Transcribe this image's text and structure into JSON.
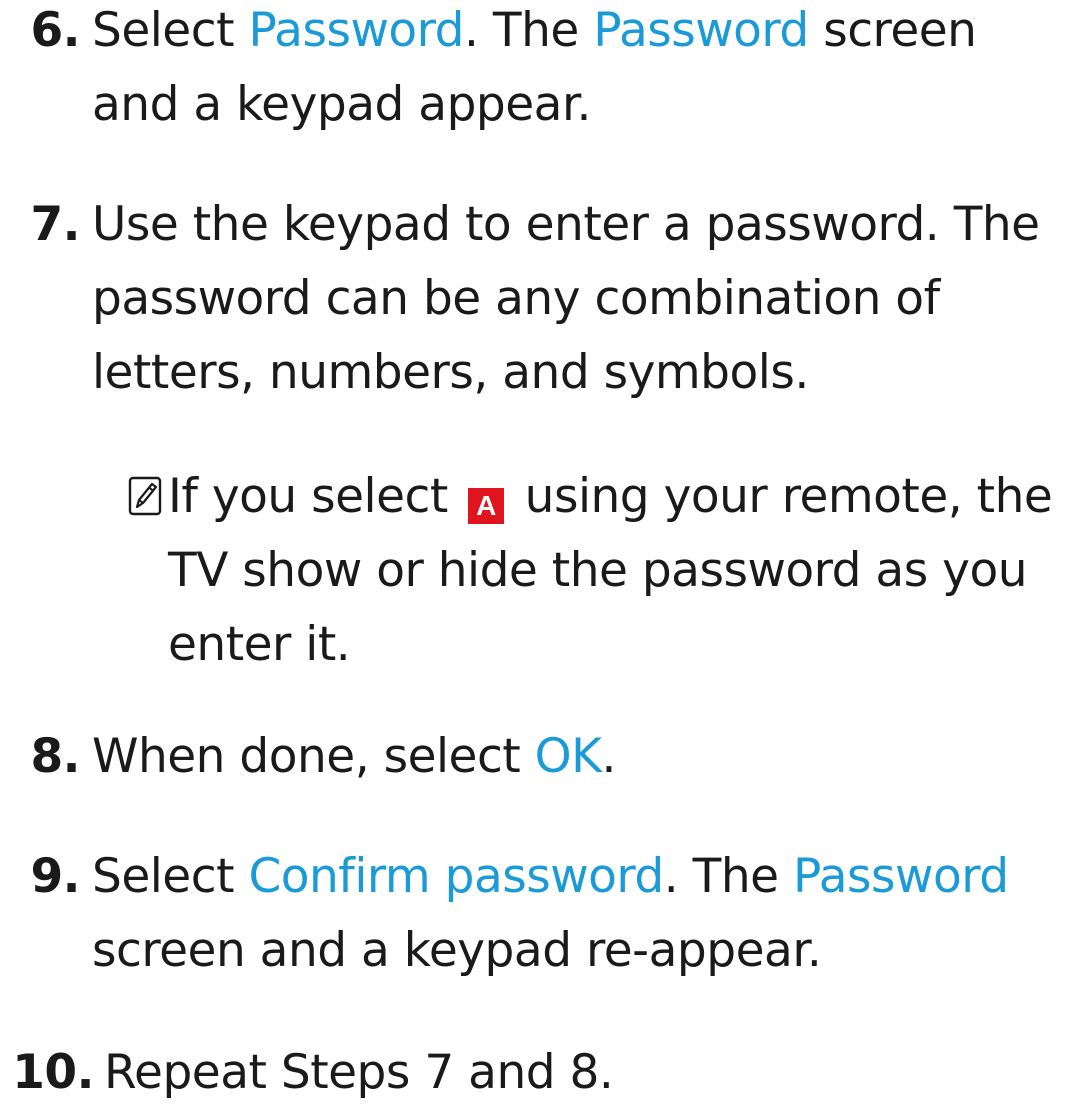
{
  "steps": [
    {
      "number": "6.",
      "parts": [
        "Select ",
        "Password",
        ". The ",
        "Password",
        " screen",
        "and a keypad appear."
      ]
    },
    {
      "number": "7.",
      "lines": [
        "Use the keypad to enter a password. The",
        "password can be any combination of",
        "letters, numbers, and symbols."
      ]
    },
    {
      "number": "8.",
      "parts": [
        "When done, select ",
        "OK",
        "."
      ]
    },
    {
      "number": "9.",
      "parts": [
        "Select ",
        "Confirm password",
        ". The ",
        "Password",
        "screen and a keypad re-appear."
      ]
    },
    {
      "number": "10.",
      "text": "Repeat Steps 7 and 8."
    }
  ],
  "note": {
    "icon": "note-pencil-icon",
    "before": "If you select",
    "button_label": "A",
    "button_color": "#e0141e",
    "after_line1": "using your remote, the",
    "line2": "TV show or hide the password as you",
    "line3": "enter it."
  },
  "colors": {
    "link": "#1a9ad6",
    "text": "#1a1a1a"
  }
}
